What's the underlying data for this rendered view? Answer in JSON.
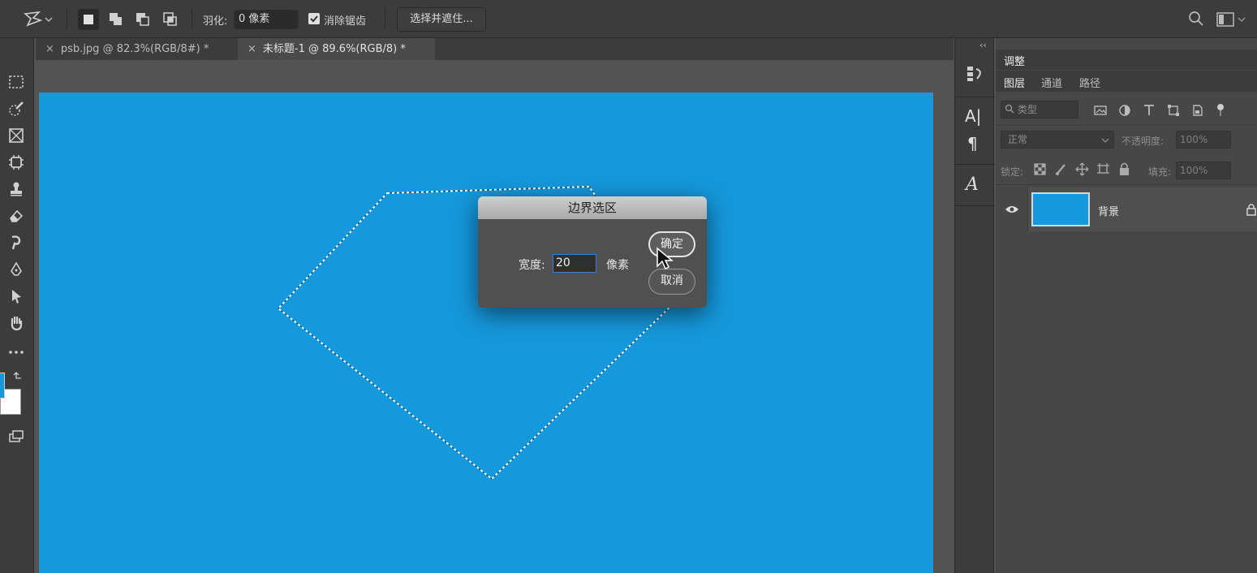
{
  "options_bar": {
    "feather_label": "羽化:",
    "feather_value": "0 像素",
    "antialias_label": "消除锯齿",
    "antialias_checked": true,
    "select_mask_label": "选择并遮住..."
  },
  "doc_tabs": [
    {
      "label": "psb.jpg @ 82.3%(RGB/8#) *",
      "active": false
    },
    {
      "label": "未标题-1 @ 89.6%(RGB/8) *",
      "active": true
    }
  ],
  "canvas": {
    "background_color": "#1598dc"
  },
  "dialog": {
    "title": "边界选区",
    "width_label": "宽度:",
    "width_value": "20",
    "unit_label": "像素",
    "ok_label": "确定",
    "cancel_label": "取消"
  },
  "panels": {
    "top_tab": "调整",
    "tabs": [
      "图层",
      "通道",
      "路径"
    ],
    "filter_placeholder": "类型",
    "blend_mode": "正常",
    "opacity_label": "不透明度:",
    "opacity_value": "100%",
    "lock_label": "锁定:",
    "fill_label": "填充:",
    "fill_value": "100%",
    "layers": [
      {
        "name": "背景",
        "color": "#1598dc",
        "locked": true
      }
    ]
  }
}
